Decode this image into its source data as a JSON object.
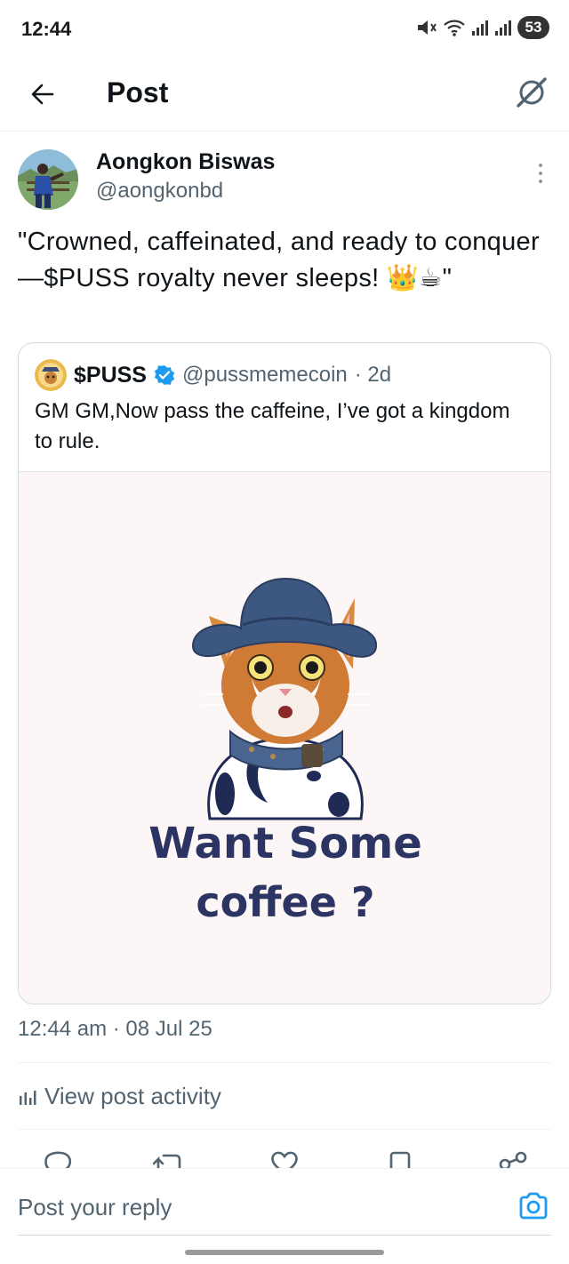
{
  "status_bar": {
    "time": "12:44",
    "battery": "53"
  },
  "header": {
    "title": "Post"
  },
  "post": {
    "author_name": "Aongkon Biswas",
    "author_handle": "@aongkonbd",
    "text": "\"Crowned, caffeinated, and ready to conquer—$PUSS royalty never sleeps! 👑☕\"",
    "timestamp": "12:44 am · 08 Jul 25"
  },
  "quote": {
    "name": "$PUSS",
    "handle": "@pussmemecoin",
    "age": "· 2d",
    "text": "GM GM,Now pass the caffeine, I’ve got a kingdom to rule.",
    "image_caption_line1": "Want Some",
    "image_caption_line2": "coffee ?"
  },
  "activity": {
    "label": "View post activity"
  },
  "reply": {
    "placeholder": "Post your reply"
  },
  "colors": {
    "accent": "#1d9bf0",
    "text": "#0f1419",
    "muted": "#536471",
    "border": "#cfd9de",
    "caption": "#2b3462"
  },
  "icons": {
    "back": "arrow-left-icon",
    "grok": "grok-icon",
    "more": "more-vertical-icon",
    "verified": "verified-badge-icon",
    "activity": "bar-chart-icon",
    "reply": "reply-icon",
    "repost": "repost-icon",
    "like": "heart-icon",
    "bookmark": "bookmark-icon",
    "share": "share-icon",
    "camera": "camera-icon"
  }
}
